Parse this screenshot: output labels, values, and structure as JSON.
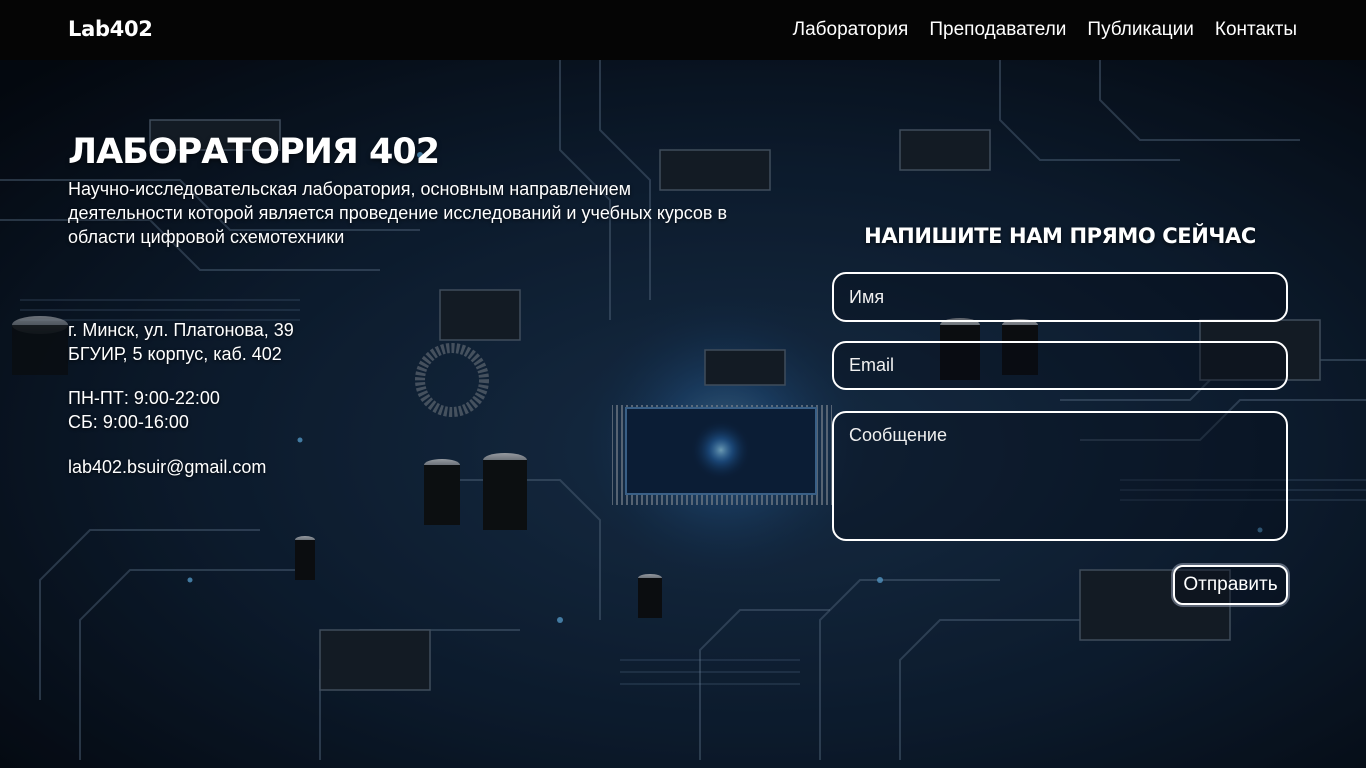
{
  "nav": {
    "logo": "Lab402",
    "items": [
      {
        "label": "Лаборатория"
      },
      {
        "label": "Преподаватели"
      },
      {
        "label": "Публикации"
      },
      {
        "label": "Контакты"
      }
    ]
  },
  "hero": {
    "title": "ЛАБОРАТОРИЯ 402",
    "description": "Научно-исследовательская лаборатория, основным направлением деятельности которой является проведение исследований и учебных курсов в области цифровой схемотехники"
  },
  "contacts": {
    "address_line1": "г. Минск, ул. Платонова, 39",
    "address_line2": "БГУИР, 5 корпус, каб. 402",
    "hours_weekdays": "ПН-ПТ: 9:00-22:00",
    "hours_saturday": "СБ: 9:00-16:00",
    "email": "lab402.bsuir@gmail.com"
  },
  "form": {
    "title": "НАПИШИТЕ НАМ ПРЯМО СЕЙЧАС",
    "name_placeholder": "Имя",
    "email_placeholder": "Email",
    "message_placeholder": "Сообщение",
    "submit_label": "Отправить"
  },
  "colors": {
    "topbar": "#050505",
    "background": "#0a1626",
    "accent_glow": "#3fa0ff"
  }
}
